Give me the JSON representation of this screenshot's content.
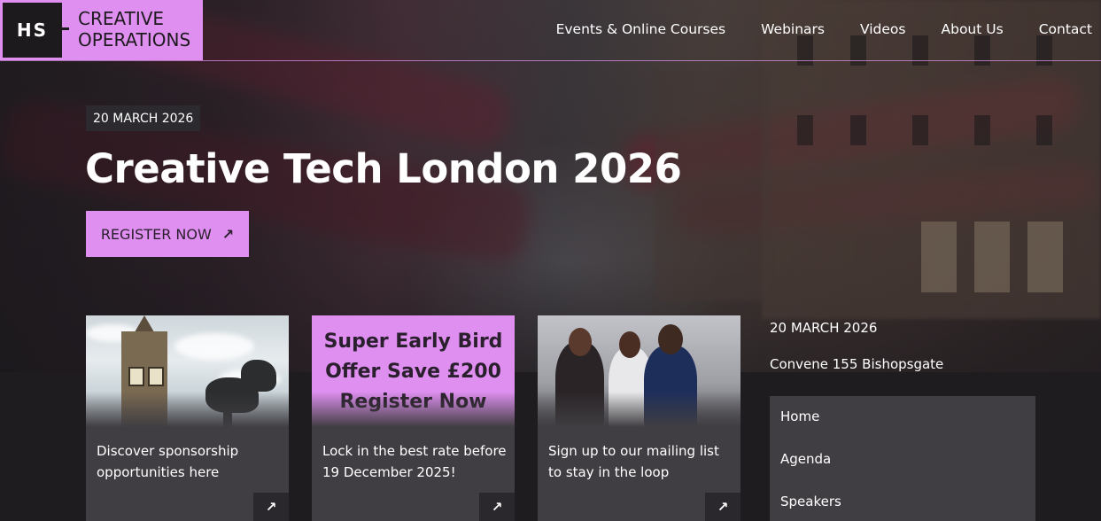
{
  "logo": {
    "mark": "HS",
    "line1": "CREATIVE",
    "line2": "OPERATIONS"
  },
  "nav": {
    "items": [
      {
        "label": "Events & Online Courses"
      },
      {
        "label": "Webinars"
      },
      {
        "label": "Videos"
      },
      {
        "label": "About Us"
      },
      {
        "label": "Contact"
      }
    ]
  },
  "hero": {
    "date": "20 MARCH 2026",
    "title": "Creative Tech London 2026",
    "register_label": "REGISTER NOW",
    "register_icon": "arrow-up-right-icon"
  },
  "cards": [
    {
      "text": "Discover sponsorship opportunities here",
      "icon": "arrow-up-right-icon"
    },
    {
      "promo": "Super Early Bird Offer Save £200 Register Now",
      "text": "Lock in the best rate before 19 December 2025!",
      "icon": "arrow-up-right-icon"
    },
    {
      "text": "Sign up to our mailing list to stay in the loop",
      "icon": "arrow-up-right-icon"
    }
  ],
  "sidebar": {
    "date": "20 MARCH 2026",
    "venue": "Convene 155 Bishopsgate",
    "menu": [
      {
        "label": "Home"
      },
      {
        "label": "Agenda"
      },
      {
        "label": "Speakers"
      }
    ]
  },
  "colors": {
    "accent": "#df8ff0",
    "dark": "#1d1a1e",
    "card": "#403e42"
  }
}
